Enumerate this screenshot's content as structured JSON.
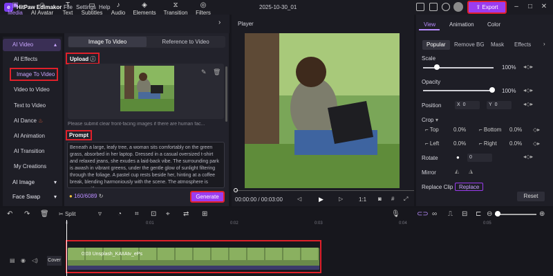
{
  "app": {
    "name": "HitPaw Edimakor",
    "window_title": "2025-10-30_01",
    "menu": [
      "File",
      "Settings",
      "Help"
    ],
    "export_label": "Export"
  },
  "tabs": [
    {
      "label": "Media",
      "icon": "media-icon"
    },
    {
      "label": "AI Avatar",
      "icon": "ai-avatar-icon"
    },
    {
      "label": "Text",
      "icon": "text-icon"
    },
    {
      "label": "Subtitles",
      "icon": "subtitles-icon"
    },
    {
      "label": "Audio",
      "icon": "audio-icon"
    },
    {
      "label": "Elements",
      "icon": "elements-icon"
    },
    {
      "label": "Transition",
      "icon": "transition-icon"
    },
    {
      "label": "Filters",
      "icon": "filters-icon"
    }
  ],
  "sidebar": {
    "ai_video": "AI Video",
    "items": [
      "AI Effects",
      "Image To Video",
      "Video to Video",
      "Text to Video",
      "AI Dance",
      "AI Animation",
      "AI Transition",
      "My Creations"
    ],
    "ai_image": "AI Image",
    "face_swap": "Face Swap"
  },
  "panel": {
    "seg_left": "Image To Video",
    "seg_right": "Reference to Video",
    "upload_label": "Upload",
    "hint": "Please submit clear front-facing images if there are human fac...",
    "prompt_label": "Prompt",
    "prompt_text": "Beneath a large, leafy tree, a woman sits comfortably on the green grass, absorbed in her laptop. Dressed in a casual oversized t-shirt and relaxed jeans, she exudes a laid-back vibe. The surrounding park is awash in vibrant greens, under the gentle glow of sunlight filtering through the foliage. A pastel cup rests beside her, hinting at a coffee break, blending harmoniously with the scene. The atmosphere is serene, with",
    "credits": "160/6089",
    "generate_label": "Generate"
  },
  "player": {
    "label": "Player",
    "timecode": "00:00:00 / 00:03:00",
    "ratio": "1:1"
  },
  "right": {
    "tabs": [
      "View",
      "Animation",
      "Color"
    ],
    "chips": [
      "Popular",
      "Remove BG",
      "Mask",
      "Effects"
    ],
    "scale_label": "Scale",
    "scale_value": "100%",
    "opacity_label": "Opacity",
    "opacity_value": "100%",
    "position_label": "Position",
    "pos_x_label": "X",
    "pos_x": "0",
    "pos_y_label": "Y",
    "pos_y": "0",
    "crop_label": "Crop",
    "crop_top": "Top",
    "crop_top_val": "0.0%",
    "crop_bottom": "Bottom",
    "crop_bottom_val": "0.0%",
    "crop_left": "Left",
    "crop_left_val": "0.0%",
    "crop_right": "Right",
    "crop_right_val": "0.0%",
    "rotate_label": "Rotate",
    "rotate_val": "0",
    "mirror_label": "Mirror",
    "replace_clip_label": "Replace Clip",
    "replace_btn": "Replace",
    "reset_label": "Reset"
  },
  "timeline": {
    "split_label": "Split",
    "ruler": [
      "0",
      "0:01",
      "0:02",
      "0:03",
      "0:04",
      "0:05"
    ],
    "clip_label": "0:03 Unsplash_KAIIAtv_ePs",
    "cover_label": "Cover"
  },
  "colors": {
    "accent": "#9b3cf0",
    "highlight": "#e0202a"
  }
}
